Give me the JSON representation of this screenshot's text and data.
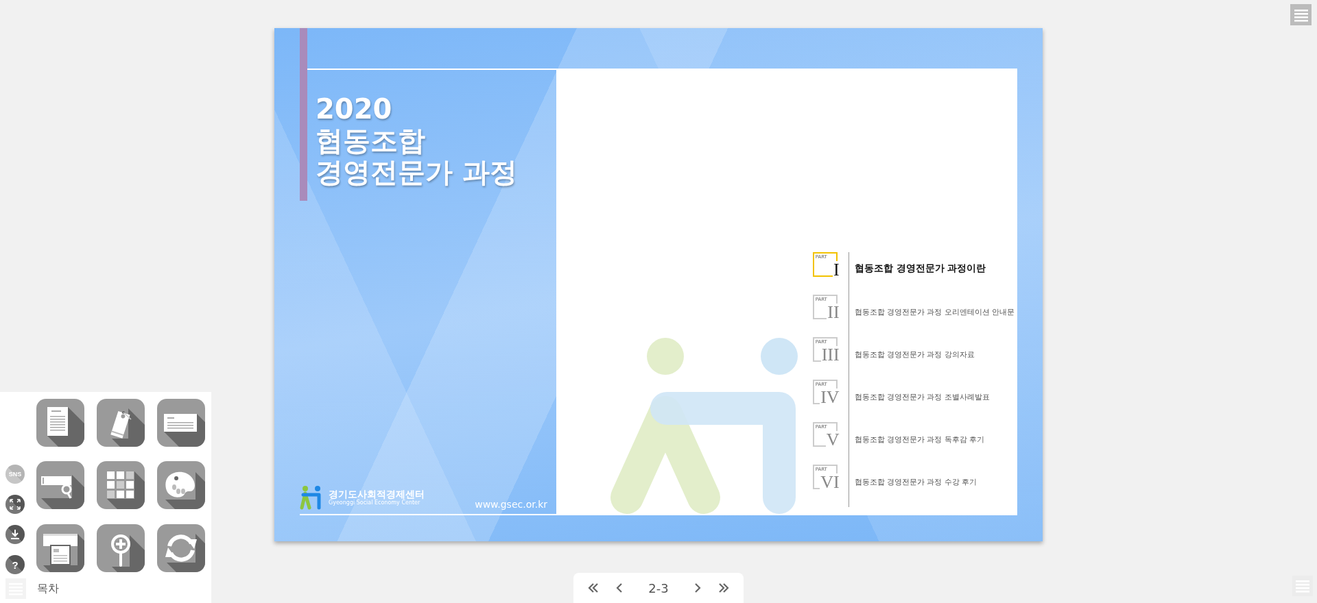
{
  "cover": {
    "year": "2020",
    "title_lines": [
      "협동조합",
      "경영전문가 과정"
    ],
    "org_name": "경기도사회적경제센터",
    "org_name_en": "Gyeonggi Social Economy Center",
    "url": "www.gsec.or.kr"
  },
  "toc": {
    "items": [
      {
        "part_label": "PART",
        "numeral": "I",
        "title": "협동조합 경영전문가 과정이란",
        "selected": true
      },
      {
        "part_label": "PART",
        "numeral": "II",
        "title": "협동조합 경영전문가 과정 오리엔테이션 안내문",
        "selected": false
      },
      {
        "part_label": "PART",
        "numeral": "III",
        "title": "협동조합 경영전문가 과정 강의자료",
        "selected": false
      },
      {
        "part_label": "PART",
        "numeral": "IV",
        "title": "협동조합 경영전문가 과정 조별사례발표",
        "selected": false
      },
      {
        "part_label": "PART",
        "numeral": "V",
        "title": "협동조합 경영전문가 과정 독후감 후기",
        "selected": false
      },
      {
        "part_label": "PART",
        "numeral": "VI",
        "title": "협동조합 경영전문가 과정 수강 후기",
        "selected": false
      }
    ]
  },
  "tools": {
    "side_buttons": [
      {
        "kind": "sns",
        "label": "SNS"
      },
      {
        "kind": "fullscreen"
      },
      {
        "kind": "download"
      },
      {
        "kind": "help",
        "label": "?"
      }
    ],
    "grid": [
      {
        "kind": "document"
      },
      {
        "kind": "tag"
      },
      {
        "kind": "card"
      },
      {
        "kind": "search"
      },
      {
        "kind": "thumbnails"
      },
      {
        "kind": "palette"
      },
      {
        "kind": "print"
      },
      {
        "kind": "zoom"
      },
      {
        "kind": "refresh"
      }
    ],
    "toc_label": "목차"
  },
  "nav": {
    "page": "2-3"
  }
}
